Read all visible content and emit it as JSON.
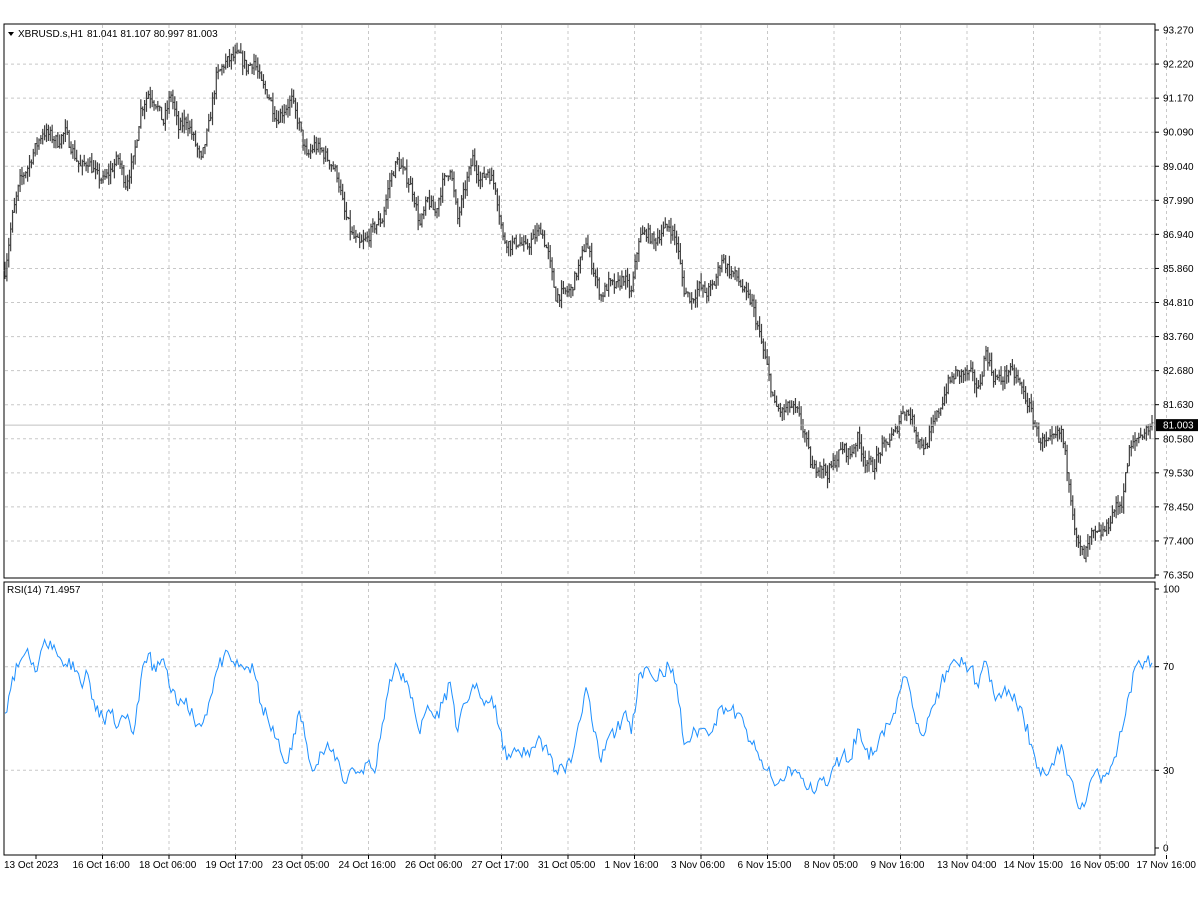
{
  "chart_data": [
    {
      "type": "bar",
      "subtype": "ohlc",
      "symbol_label": "XBRUSD.s,H1",
      "ohlc_label": "81.041 81.107 80.997 81.003",
      "last_price_label": "81.003",
      "last_price": 81.003,
      "ylim": [
        76.35,
        93.27
      ],
      "y_ticks": [
        "93.270",
        "92.220",
        "91.170",
        "90.090",
        "89.040",
        "87.990",
        "86.940",
        "85.860",
        "84.810",
        "83.760",
        "82.680",
        "81.630",
        "80.580",
        "79.530",
        "78.450",
        "77.400",
        "76.350"
      ],
      "grid": true,
      "price_path": [
        [
          0,
          85.8
        ],
        [
          1,
          87.5
        ],
        [
          2,
          88.6
        ],
        [
          3,
          89.0
        ],
        [
          4,
          89.6
        ],
        [
          5,
          90.1
        ],
        [
          6,
          90.0
        ],
        [
          7,
          89.8
        ],
        [
          8,
          90.1
        ],
        [
          9,
          89.5
        ],
        [
          10,
          89.0
        ],
        [
          11,
          89.2
        ],
        [
          12,
          88.8
        ],
        [
          13,
          88.6
        ],
        [
          14,
          88.9
        ],
        [
          15,
          89.3
        ],
        [
          16,
          88.5
        ],
        [
          17,
          89.2
        ],
        [
          18,
          90.8
        ],
        [
          19,
          91.3
        ],
        [
          20,
          91.0
        ],
        [
          21,
          90.4
        ],
        [
          22,
          91.3
        ],
        [
          23,
          90.2
        ],
        [
          24,
          90.5
        ],
        [
          25,
          89.9
        ],
        [
          26,
          89.2
        ],
        [
          27,
          90.3
        ],
        [
          28,
          91.8
        ],
        [
          29,
          92.2
        ],
        [
          30,
          92.4
        ],
        [
          31,
          92.5
        ],
        [
          32,
          92.1
        ],
        [
          33,
          92.3
        ],
        [
          34,
          91.6
        ],
        [
          35,
          91.2
        ],
        [
          36,
          90.5
        ],
        [
          37,
          90.8
        ],
        [
          38,
          91.1
        ],
        [
          39,
          90.3
        ],
        [
          40,
          89.3
        ],
        [
          41,
          89.7
        ],
        [
          42,
          89.5
        ],
        [
          43,
          89.2
        ],
        [
          44,
          88.8
        ],
        [
          45,
          87.6
        ],
        [
          46,
          86.9
        ],
        [
          47,
          86.6
        ],
        [
          48,
          86.8
        ],
        [
          49,
          87.2
        ],
        [
          50,
          87.4
        ],
        [
          51,
          88.6
        ],
        [
          52,
          89.2
        ],
        [
          53,
          88.8
        ],
        [
          54,
          88.3
        ],
        [
          55,
          87.2
        ],
        [
          56,
          88.0
        ],
        [
          57,
          87.6
        ],
        [
          58,
          88.5
        ],
        [
          59,
          89.0
        ],
        [
          60,
          87.4
        ],
        [
          61,
          88.4
        ],
        [
          62,
          89.3
        ],
        [
          63,
          88.6
        ],
        [
          64,
          88.9
        ],
        [
          65,
          88.4
        ],
        [
          66,
          86.8
        ],
        [
          67,
          86.6
        ],
        [
          68,
          86.7
        ],
        [
          69,
          86.5
        ],
        [
          70,
          86.8
        ],
        [
          71,
          87.1
        ],
        [
          72,
          86.3
        ],
        [
          73,
          85.0
        ],
        [
          74,
          85.1
        ],
        [
          75,
          85.2
        ],
        [
          76,
          85.9
        ],
        [
          77,
          86.7
        ],
        [
          78,
          85.8
        ],
        [
          79,
          85.0
        ],
        [
          80,
          85.4
        ],
        [
          81,
          85.3
        ],
        [
          82,
          85.6
        ],
        [
          83,
          85.1
        ],
        [
          84,
          86.8
        ],
        [
          85,
          87.0
        ],
        [
          86,
          86.7
        ],
        [
          87,
          87.0
        ],
        [
          88,
          87.2
        ],
        [
          89,
          86.7
        ],
        [
          90,
          85.2
        ],
        [
          91,
          84.9
        ],
        [
          92,
          85.3
        ],
        [
          93,
          85.1
        ],
        [
          94,
          85.4
        ],
        [
          95,
          86.2
        ],
        [
          96,
          85.8
        ],
        [
          97,
          85.6
        ],
        [
          98,
          85.1
        ],
        [
          99,
          84.8
        ],
        [
          100,
          83.8
        ],
        [
          101,
          82.8
        ],
        [
          102,
          81.6
        ],
        [
          103,
          81.4
        ],
        [
          104,
          81.6
        ],
        [
          105,
          81.4
        ],
        [
          106,
          80.7
        ],
        [
          107,
          79.6
        ],
        [
          108,
          79.8
        ],
        [
          109,
          79.5
        ],
        [
          110,
          79.9
        ],
        [
          111,
          80.3
        ],
        [
          112,
          80.1
        ],
        [
          113,
          80.6
        ],
        [
          114,
          79.9
        ],
        [
          115,
          79.7
        ],
        [
          116,
          80.2
        ],
        [
          117,
          80.5
        ],
        [
          118,
          80.8
        ],
        [
          119,
          81.5
        ],
        [
          120,
          81.3
        ],
        [
          121,
          80.6
        ],
        [
          122,
          80.3
        ],
        [
          123,
          81.0
        ],
        [
          124,
          81.6
        ],
        [
          125,
          82.3
        ],
        [
          126,
          82.6
        ],
        [
          127,
          82.6
        ],
        [
          128,
          82.6
        ],
        [
          129,
          82.1
        ],
        [
          130,
          83.3
        ],
        [
          131,
          82.5
        ],
        [
          132,
          82.4
        ],
        [
          133,
          82.7
        ],
        [
          134,
          82.5
        ],
        [
          135,
          82.0
        ],
        [
          136,
          81.4
        ],
        [
          137,
          80.6
        ],
        [
          138,
          80.4
        ],
        [
          139,
          80.6
        ],
        [
          140,
          80.8
        ],
        [
          141,
          79.3
        ],
        [
          142,
          77.4
        ],
        [
          143,
          76.9
        ],
        [
          144,
          77.6
        ],
        [
          145,
          77.6
        ],
        [
          146,
          77.8
        ],
        [
          147,
          78.4
        ],
        [
          148,
          78.6
        ],
        [
          149,
          80.2
        ],
        [
          150,
          80.6
        ],
        [
          151,
          80.8
        ],
        [
          152,
          81.0
        ]
      ]
    },
    {
      "type": "line",
      "indicator_label": "RSI(14) 71.4957",
      "ylim": [
        0,
        100
      ],
      "y_ticks": [
        "100",
        "70",
        "30",
        "0"
      ],
      "levels": [
        70,
        30
      ],
      "series": [
        {
          "color": "#1e90ff",
          "points": [
            [
              0,
              52
            ],
            [
              1,
              66
            ],
            [
              2,
              72
            ],
            [
              3,
              77
            ],
            [
              4,
              68
            ],
            [
              5,
              78
            ],
            [
              6,
              80
            ],
            [
              7,
              74
            ],
            [
              8,
              71
            ],
            [
              9,
              72
            ],
            [
              10,
              64
            ],
            [
              11,
              67
            ],
            [
              12,
              53
            ],
            [
              13,
              50
            ],
            [
              14,
              52
            ],
            [
              15,
              47
            ],
            [
              16,
              50
            ],
            [
              17,
              44
            ],
            [
              18,
              65
            ],
            [
              19,
              75
            ],
            [
              20,
              68
            ],
            [
              21,
              73
            ],
            [
              22,
              60
            ],
            [
              23,
              55
            ],
            [
              24,
              58
            ],
            [
              25,
              50
            ],
            [
              26,
              47
            ],
            [
              27,
              56
            ],
            [
              28,
              68
            ],
            [
              29,
              74
            ],
            [
              30,
              72
            ],
            [
              31,
              70
            ],
            [
              32,
              70
            ],
            [
              33,
              68
            ],
            [
              34,
              55
            ],
            [
              35,
              48
            ],
            [
              36,
              42
            ],
            [
              37,
              33
            ],
            [
              38,
              38
            ],
            [
              39,
              53
            ],
            [
              40,
              40
            ],
            [
              41,
              30
            ],
            [
              42,
              37
            ],
            [
              43,
              38
            ],
            [
              44,
              35
            ],
            [
              45,
              25
            ],
            [
              46,
              31
            ],
            [
              47,
              29
            ],
            [
              48,
              33
            ],
            [
              49,
              29
            ],
            [
              50,
              48
            ],
            [
              51,
              65
            ],
            [
              52,
              70
            ],
            [
              53,
              64
            ],
            [
              54,
              58
            ],
            [
              55,
              44
            ],
            [
              56,
              55
            ],
            [
              57,
              50
            ],
            [
              58,
              56
            ],
            [
              59,
              64
            ],
            [
              60,
              45
            ],
            [
              61,
              56
            ],
            [
              62,
              63
            ],
            [
              63,
              58
            ],
            [
              64,
              56
            ],
            [
              65,
              55
            ],
            [
              66,
              38
            ],
            [
              67,
              35
            ],
            [
              68,
              38
            ],
            [
              69,
              36
            ],
            [
              70,
              39
            ],
            [
              71,
              42
            ],
            [
              72,
              36
            ],
            [
              73,
              30
            ],
            [
              74,
              31
            ],
            [
              75,
              33
            ],
            [
              76,
              48
            ],
            [
              77,
              62
            ],
            [
              78,
              45
            ],
            [
              79,
              33
            ],
            [
              80,
              43
            ],
            [
              81,
              45
            ],
            [
              82,
              52
            ],
            [
              83,
              44
            ],
            [
              84,
              67
            ],
            [
              85,
              70
            ],
            [
              86,
              65
            ],
            [
              87,
              68
            ],
            [
              88,
              70
            ],
            [
              89,
              63
            ],
            [
              90,
              40
            ],
            [
              91,
              43
            ],
            [
              92,
              46
            ],
            [
              93,
              45
            ],
            [
              94,
              48
            ],
            [
              95,
              55
            ],
            [
              96,
              53
            ],
            [
              97,
              52
            ],
            [
              98,
              47
            ],
            [
              99,
              40
            ],
            [
              100,
              34
            ],
            [
              101,
              30
            ],
            [
              102,
              24
            ],
            [
              103,
              26
            ],
            [
              104,
              31
            ],
            [
              105,
              29
            ],
            [
              106,
              24
            ],
            [
              107,
              22
            ],
            [
              108,
              27
            ],
            [
              109,
              24
            ],
            [
              110,
              32
            ],
            [
              111,
              36
            ],
            [
              112,
              34
            ],
            [
              113,
              46
            ],
            [
              114,
              38
            ],
            [
              115,
              36
            ],
            [
              116,
              44
            ],
            [
              117,
              48
            ],
            [
              118,
              52
            ],
            [
              119,
              66
            ],
            [
              120,
              60
            ],
            [
              121,
              48
            ],
            [
              122,
              45
            ],
            [
              123,
              55
            ],
            [
              124,
              63
            ],
            [
              125,
              68
            ],
            [
              126,
              72
            ],
            [
              127,
              71
            ],
            [
              128,
              70
            ],
            [
              129,
              62
            ],
            [
              130,
              72
            ],
            [
              131,
              60
            ],
            [
              132,
              58
            ],
            [
              133,
              61
            ],
            [
              134,
              56
            ],
            [
              135,
              50
            ],
            [
              136,
              40
            ],
            [
              137,
              31
            ],
            [
              138,
              28
            ],
            [
              139,
              32
            ],
            [
              140,
              40
            ],
            [
              141,
              28
            ],
            [
              142,
              18
            ],
            [
              143,
              16
            ],
            [
              144,
              27
            ],
            [
              145,
              28
            ],
            [
              146,
              29
            ],
            [
              147,
              35
            ],
            [
              148,
              45
            ],
            [
              149,
              60
            ],
            [
              150,
              71
            ],
            [
              151,
              72
            ],
            [
              152,
              71.5
            ]
          ]
        }
      ]
    }
  ],
  "x_axis_labels": [
    "13 Oct 2023",
    "16 Oct 16:00",
    "18 Oct 06:00",
    "19 Oct 17:00",
    "23 Oct 05:00",
    "24 Oct 16:00",
    "26 Oct 06:00",
    "27 Oct 17:00",
    "31 Oct 05:00",
    "1 Nov 16:00",
    "3 Nov 06:00",
    "6 Nov 15:00",
    "8 Nov 05:00",
    "9 Nov 16:00",
    "13 Nov 04:00",
    "14 Nov 15:00",
    "16 Nov 05:00",
    "17 Nov 16:00"
  ],
  "colors": {
    "background": "#ffffff",
    "candles": "#404040",
    "grid": "#c8c8c8",
    "rsi_line": "#1e90ff",
    "price_line": "#c0c0c0",
    "price_label_bg": "#000000"
  }
}
